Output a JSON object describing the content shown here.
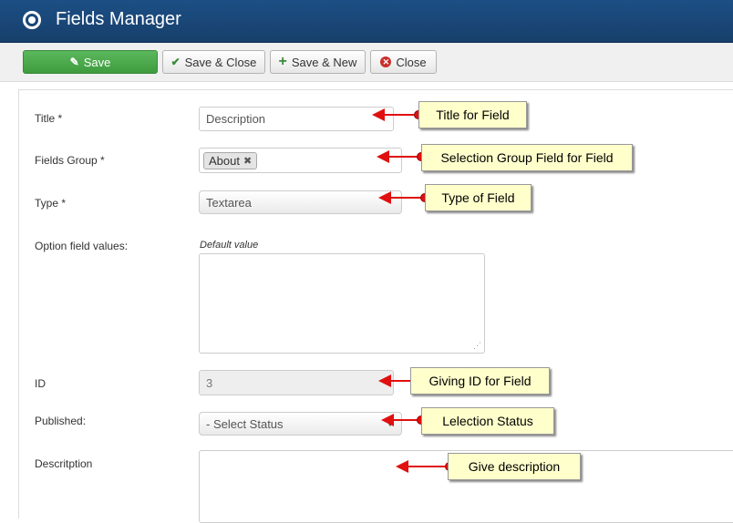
{
  "header": {
    "title": "Fields Manager"
  },
  "toolbar": {
    "save": "Save",
    "save_close": "Save & Close",
    "save_new": "Save & New",
    "close": "Close"
  },
  "form": {
    "title_label": "Title *",
    "title_value": "Description",
    "group_label": "Fields Group *",
    "group_tag": "About",
    "type_label": "Type *",
    "type_value": "Textarea",
    "option_label": "Option field values:",
    "default_value_label": "Default value",
    "id_label": "ID",
    "id_value": "3",
    "published_label": "Published:",
    "published_value": "- Select Status",
    "description_label": "Descritption"
  },
  "callouts": {
    "title": "Title for Field",
    "group": "Selection Group Field for Field",
    "type": "Type of Field",
    "id": "Giving ID for Field",
    "status": "Lelection Status",
    "description": "Give description"
  },
  "colors": {
    "header": "#1c4f85",
    "save_button": "#4cae4c",
    "callout_bg": "#ffffcc",
    "arrow": "#e01010"
  }
}
